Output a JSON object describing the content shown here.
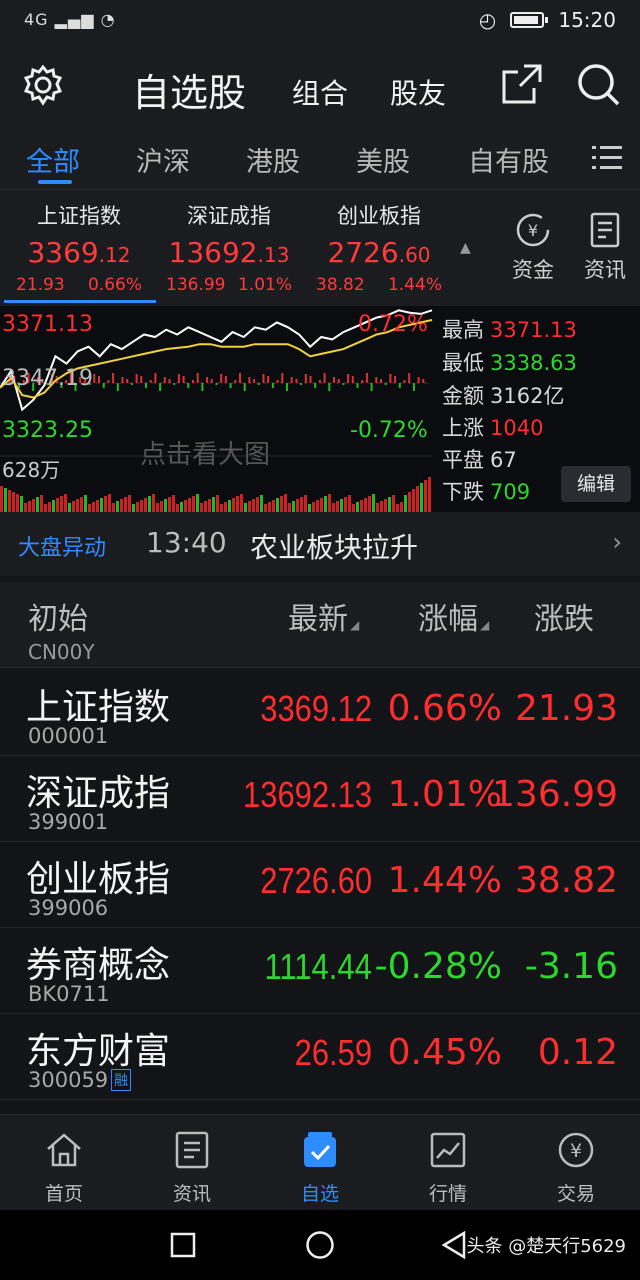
{
  "status_bar": {
    "signal": "4G",
    "time": "15:20"
  },
  "header": {
    "title": "自选股",
    "group": "组合",
    "friends": "股友"
  },
  "tabs": [
    "全部",
    "沪深",
    "港股",
    "美股",
    "自有股"
  ],
  "indices": [
    {
      "name": "上证指数",
      "price_main": "3369",
      "price_dec": ".12",
      "change": "21.93",
      "pct": "0.66%"
    },
    {
      "name": "深证成指",
      "price_main": "13692",
      "price_dec": ".13",
      "change": "136.99",
      "pct": "1.01%"
    },
    {
      "name": "创业板指",
      "price_main": "2726",
      "price_dec": ".60",
      "change": "38.82",
      "pct": "1.44%"
    }
  ],
  "side_buttons": {
    "funds": "资金",
    "news": "资讯"
  },
  "chart": {
    "high_label": "3371.13",
    "high_pct": "0.72%",
    "mid_label": "3347.19",
    "low_label": "3323.25",
    "low_pct": "-0.72%",
    "volume_label": "628万",
    "hint": "点击看大图"
  },
  "chart_data": {
    "type": "line",
    "ylim": [
      3323.25,
      3371.13
    ],
    "series": [
      {
        "values": [
          3339,
          3346,
          3330,
          3334,
          3340,
          3352,
          3349,
          3354,
          3356,
          3352,
          3357,
          3355,
          3358,
          3361,
          3360,
          3363,
          3361,
          3364,
          3362,
          3360,
          3358,
          3362,
          3360,
          3364,
          3363,
          3366,
          3364,
          3361,
          3356,
          3360,
          3359,
          3362,
          3364,
          3366,
          3368,
          3369,
          3371,
          3370,
          3369.5,
          3371
        ]
      },
      {
        "values": [
          3339,
          3343,
          3336,
          3335,
          3337,
          3342,
          3345,
          3347,
          3348,
          3349,
          3350,
          3351,
          3352,
          3353,
          3354,
          3355,
          3355.5,
          3356,
          3357,
          3357,
          3356,
          3356,
          3356,
          3357,
          3357,
          3357,
          3357,
          3355,
          3352,
          3353,
          3354,
          3355,
          3357,
          3359,
          3361,
          3362,
          3364,
          3365,
          3366,
          3367
        ]
      }
    ]
  },
  "stats": {
    "high": {
      "label": "最高",
      "value": "3371.13"
    },
    "low": {
      "label": "最低",
      "value": "3338.63"
    },
    "amount": {
      "label": "金额",
      "value": "3162亿"
    },
    "up": {
      "label": "上涨",
      "value": "1040"
    },
    "flat": {
      "label": "平盘",
      "value": "67"
    },
    "down": {
      "label": "下跌",
      "value": "709"
    },
    "edit": "编辑"
  },
  "news": {
    "tag": "大盘异动",
    "time": "13:40",
    "text": "农业板块拉升"
  },
  "table": {
    "headers": {
      "name": "初始",
      "latest": "最新",
      "pct": "涨幅",
      "change": "涨跌"
    },
    "partial_code": "CN00Y",
    "rows": [
      {
        "name": "上证指数",
        "code": "000001",
        "latest": "3369.12",
        "pct": "0.66%",
        "change": "21.93",
        "dir": "up",
        "badge": ""
      },
      {
        "name": "深证成指",
        "code": "399001",
        "latest": "13692.13",
        "pct": "1.01%",
        "change": "136.99",
        "dir": "up",
        "badge": ""
      },
      {
        "name": "创业板指",
        "code": "399006",
        "latest": "2726.60",
        "pct": "1.44%",
        "change": "38.82",
        "dir": "up",
        "badge": ""
      },
      {
        "name": "券商概念",
        "code": "BK0711",
        "latest": "1114.44",
        "pct": "-0.28%",
        "change": "-3.16",
        "dir": "down",
        "badge": ""
      },
      {
        "name": "东方财富",
        "code": "300059",
        "latest": "26.59",
        "pct": "0.45%",
        "change": "0.12",
        "dir": "up",
        "badge": "融"
      }
    ]
  },
  "bottom_nav": [
    "首页",
    "资讯",
    "自选",
    "行情",
    "交易"
  ],
  "watermark": "头条 @楚天行5629",
  "colors": {
    "up": "#ff2d2d",
    "down": "#2ed72e",
    "accent": "#2f8cff"
  }
}
